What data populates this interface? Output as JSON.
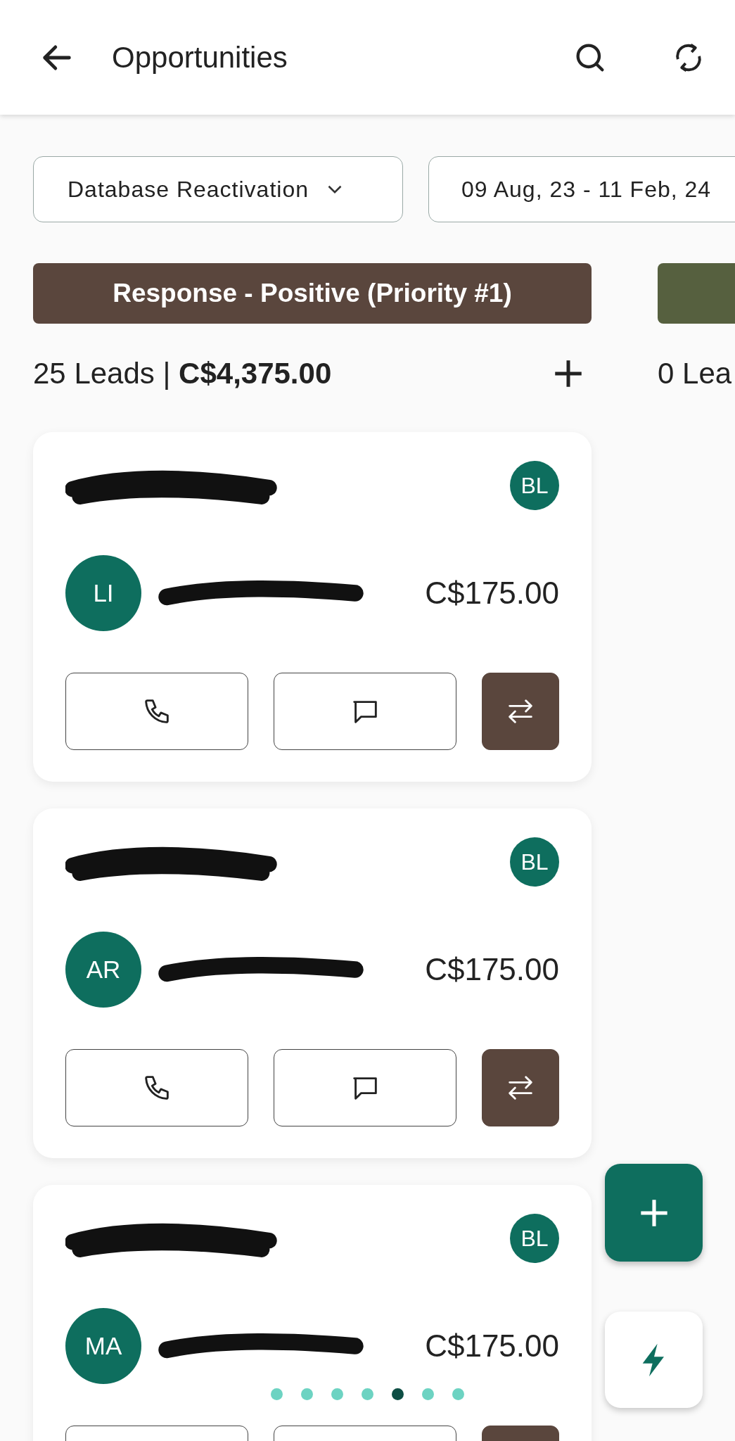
{
  "header": {
    "title": "Opportunities"
  },
  "filters": {
    "pipeline": "Database Reactivation",
    "date_range": "09 Aug, 23 - 11 Feb, 24"
  },
  "stages": [
    {
      "title": "Response - Positive (Priority #1)",
      "color": "#5a463d",
      "summary": "25 Leads | **C$4,375.00**",
      "cards": [
        {
          "badge": "BL",
          "initials": "LI",
          "amount": "C$175.00"
        },
        {
          "badge": "BL",
          "initials": "AR",
          "amount": "C$175.00"
        },
        {
          "badge": "BL",
          "initials": "MA",
          "amount": "C$175.00"
        }
      ]
    },
    {
      "color": "#56603f",
      "summary": "0 Lea"
    }
  ],
  "page_dots": [
    {
      "selected": false
    },
    {
      "selected": false
    },
    {
      "selected": false
    },
    {
      "selected": false
    },
    {
      "selected": true
    },
    {
      "selected": false
    },
    {
      "selected": false
    }
  ]
}
